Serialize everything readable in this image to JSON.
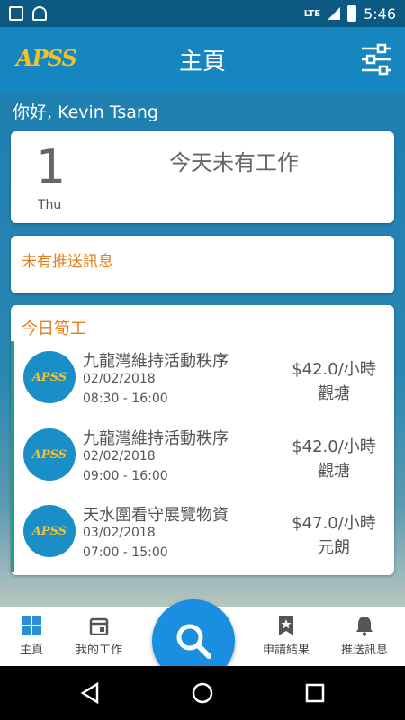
{
  "status_bar": {
    "time": "5:46",
    "network": "LTE"
  },
  "app_bar": {
    "logo_text": "APSS",
    "title": "主頁"
  },
  "greeting": "你好, Kevin Tsang",
  "day_card": {
    "day_number": "1",
    "weekday": "Thu",
    "message": "今天未有工作"
  },
  "push_card": {
    "message": "未有推送訊息"
  },
  "jobs": {
    "title": "今日筍工",
    "items": [
      {
        "logo": "APSS",
        "name": "九龍灣維持活動秩序",
        "date": "02/02/2018",
        "time": "08:30 - 16:00",
        "wage": "$42.0/小時",
        "location": "觀塘"
      },
      {
        "logo": "APSS",
        "name": "九龍灣維持活動秩序",
        "date": "02/02/2018",
        "time": "09:00 - 16:00",
        "wage": "$42.0/小時",
        "location": "觀塘"
      },
      {
        "logo": "APSS",
        "name": "天水圍看守展覽物資",
        "date": "03/02/2018",
        "time": "07:00 - 15:00",
        "wage": "$47.0/小時",
        "location": "元朗"
      }
    ]
  },
  "bottom_nav": {
    "home": "主頁",
    "my_jobs": "我的工作",
    "results": "申請結果",
    "push": "推送訊息"
  },
  "colors": {
    "primary": "#1586c0",
    "accent": "#e47e1f",
    "fab": "#1a8ee0",
    "job_bar": "#21a182"
  }
}
